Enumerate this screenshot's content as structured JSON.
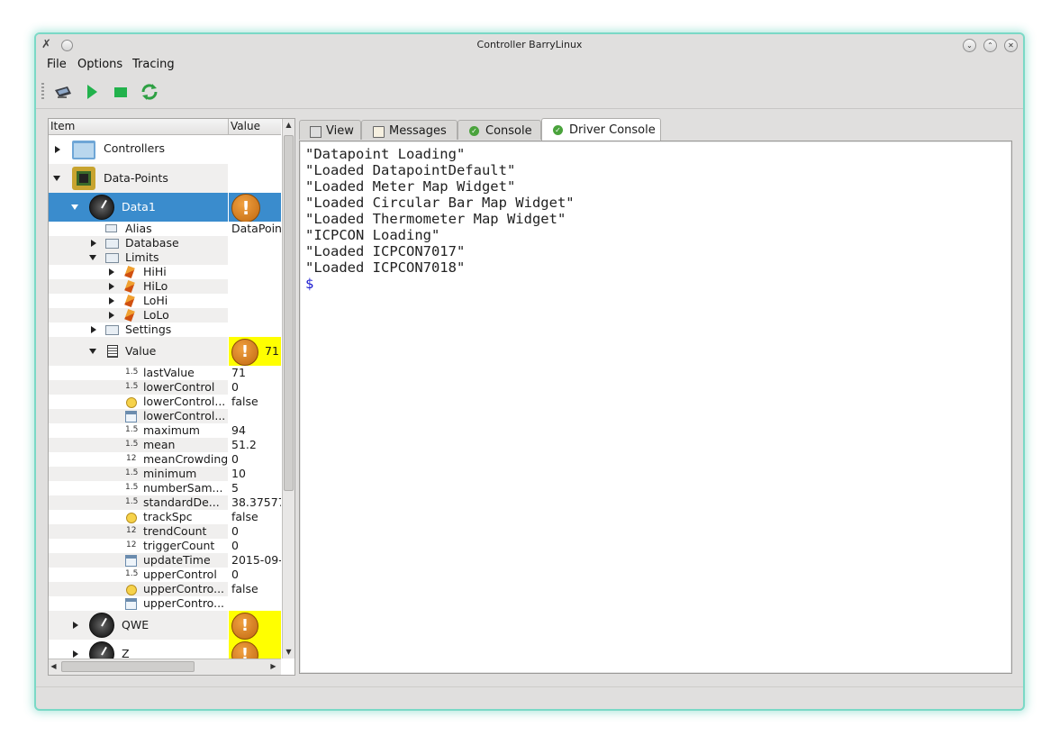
{
  "window": {
    "title": "Controller BarryLinux"
  },
  "menu": {
    "file": "File",
    "options": "Options",
    "tracing": "Tracing"
  },
  "toolbar": {
    "buttons": [
      "connect-icon",
      "play-icon",
      "stop-icon",
      "refresh-icon"
    ]
  },
  "tree": {
    "headers": {
      "item": "Item",
      "value": "Value"
    },
    "rows": [
      {
        "label": "Controllers",
        "value": ""
      },
      {
        "label": "Data-Points",
        "value": ""
      },
      {
        "label": "Data1",
        "value": ""
      },
      {
        "label": "Alias",
        "value": "DataPoin"
      },
      {
        "label": "Database",
        "value": ""
      },
      {
        "label": "Limits",
        "value": ""
      },
      {
        "label": "HiHi",
        "value": ""
      },
      {
        "label": "HiLo",
        "value": ""
      },
      {
        "label": "LoHi",
        "value": ""
      },
      {
        "label": "LoLo",
        "value": ""
      },
      {
        "label": "Settings",
        "value": ""
      },
      {
        "label": "Value",
        "value": "71"
      },
      {
        "label": "lastValue",
        "value": "71",
        "icon": "1.5"
      },
      {
        "label": "lowerControl",
        "value": "0",
        "icon": "1.5"
      },
      {
        "label": "lowerControl...",
        "value": "false",
        "icon": "bulb"
      },
      {
        "label": "lowerControl...",
        "value": "",
        "icon": "date"
      },
      {
        "label": "maximum",
        "value": "94",
        "icon": "1.5"
      },
      {
        "label": "mean",
        "value": "51.2",
        "icon": "1.5"
      },
      {
        "label": "meanCrowding",
        "value": "0",
        "icon": "12"
      },
      {
        "label": "minimum",
        "value": "10",
        "icon": "1.5"
      },
      {
        "label": "numberSam...",
        "value": "5",
        "icon": "1.5"
      },
      {
        "label": "standardDe...",
        "value": "38.37577",
        "icon": "1.5"
      },
      {
        "label": "trackSpc",
        "value": "false",
        "icon": "bulb"
      },
      {
        "label": "trendCount",
        "value": "0",
        "icon": "12"
      },
      {
        "label": "triggerCount",
        "value": "0",
        "icon": "12"
      },
      {
        "label": "updateTime",
        "value": "2015-09-",
        "icon": "date"
      },
      {
        "label": "upperControl",
        "value": "0",
        "icon": "1.5"
      },
      {
        "label": "upperContro...",
        "value": "false",
        "icon": "bulb"
      },
      {
        "label": "upperContro...",
        "value": "",
        "icon": "date"
      },
      {
        "label": "QWE",
        "value": ""
      },
      {
        "label": "Z",
        "value": ""
      }
    ],
    "icon_labels": {
      "float": "1.5",
      "int": "12"
    }
  },
  "tabs": [
    {
      "label": "View"
    },
    {
      "label": "Messages"
    },
    {
      "label": "Console"
    },
    {
      "label": "Driver Console",
      "active": true
    }
  ],
  "console": {
    "lines": [
      "\"Datapoint Loading\"",
      "\"Loaded DatapointDefault\"",
      "\"Loaded Meter Map Widget\"",
      "\"Loaded Circular Bar Map Widget\"",
      "\"Loaded Thermometer Map Widget\"",
      "\"ICPCON Loading\"",
      "\"Loaded ICPCON7017\"",
      "\"Loaded ICPCON7018\""
    ],
    "prompt": "$"
  },
  "colors": {
    "selection": "#3a8ccd",
    "warning_bg": "#ffff00",
    "accent_glow": "#7ad9c6"
  }
}
